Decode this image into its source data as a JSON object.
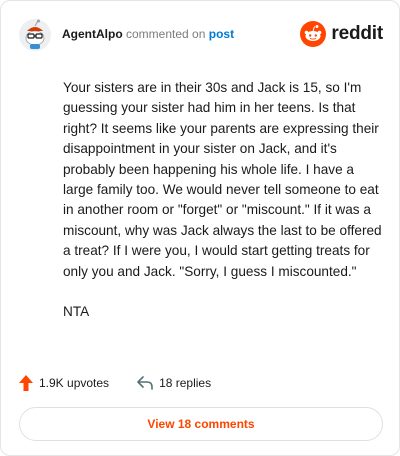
{
  "header": {
    "username": "AgentAlpo",
    "commented_on": "commented on",
    "post_link": "post",
    "logo_text": "reddit",
    "brand_color": "#ff4500",
    "avatar_icon": "snoo-avatar-icon"
  },
  "comment": {
    "paragraphs": [
      "Your sisters are in their 30s and Jack is 15, so I'm guessing your sister had him in her teens. Is that right? It seems like your parents are expressing their disappointment in your sister on Jack, and it's probably been happening his whole life. I have a large family too. We would never tell someone to eat in another room or \"forget\" or \"miscount.\" If it was a miscount, why was Jack always the last to be offered a treat? If I were you, I would start getting treats for only you and Jack. \"Sorry, I guess I miscounted.\"",
      "NTA"
    ]
  },
  "stats": {
    "upvotes": "1.9K upvotes",
    "replies": "18 replies",
    "upvote_icon": "upvote-arrow-icon",
    "reply_icon": "reply-arrow-icon"
  },
  "actions": {
    "view_comments": "View 18 comments"
  }
}
